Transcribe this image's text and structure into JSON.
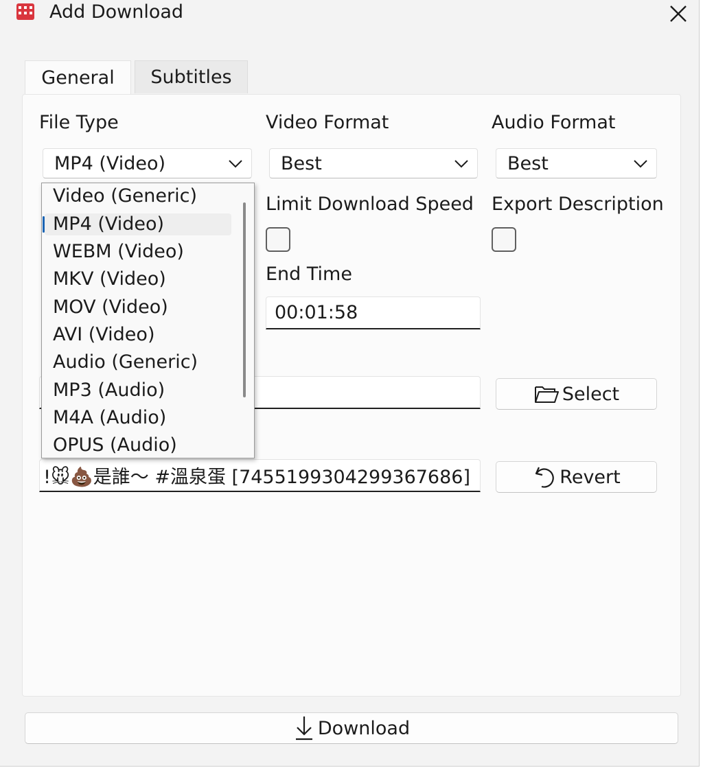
{
  "window": {
    "title": "Add Download"
  },
  "tabs": [
    {
      "label": "General",
      "active": true
    },
    {
      "label": "Subtitles",
      "active": false
    }
  ],
  "general": {
    "file_type": {
      "label": "File Type",
      "value": "MP4 (Video)"
    },
    "video_format": {
      "label": "Video Format",
      "value": "Best"
    },
    "audio_format": {
      "label": "Audio Format",
      "value": "Best"
    },
    "limit_speed": {
      "label": "Limit Download Speed",
      "checked": false
    },
    "export_description": {
      "label": "Export Description",
      "checked": false
    },
    "end_time": {
      "label": "End Time",
      "value": "00:01:58"
    },
    "save_folder": {
      "value": "",
      "select_label": "Select"
    },
    "file_name": {
      "value": "!🐭💩是誰～ #溫泉蛋 [7455199304299367686]",
      "revert_label": "Revert"
    }
  },
  "file_type_options": [
    "Video (Generic)",
    "MP4 (Video)",
    "WEBM (Video)",
    "MKV (Video)",
    "MOV (Video)",
    "AVI (Video)",
    "Audio (Generic)",
    "MP3 (Audio)",
    "M4A (Audio)",
    "OPUS (Audio)"
  ],
  "selected_option_index": 1,
  "footer": {
    "download_label": "Download"
  },
  "icons": {
    "app": "app-icon",
    "close": "close-icon",
    "chevron": "chevron-down-icon",
    "folder": "folder-icon",
    "revert": "undo-icon",
    "download": "download-arrow-icon"
  },
  "colors": {
    "app_icon": "#d9363e",
    "accent": "#1a64b4"
  }
}
